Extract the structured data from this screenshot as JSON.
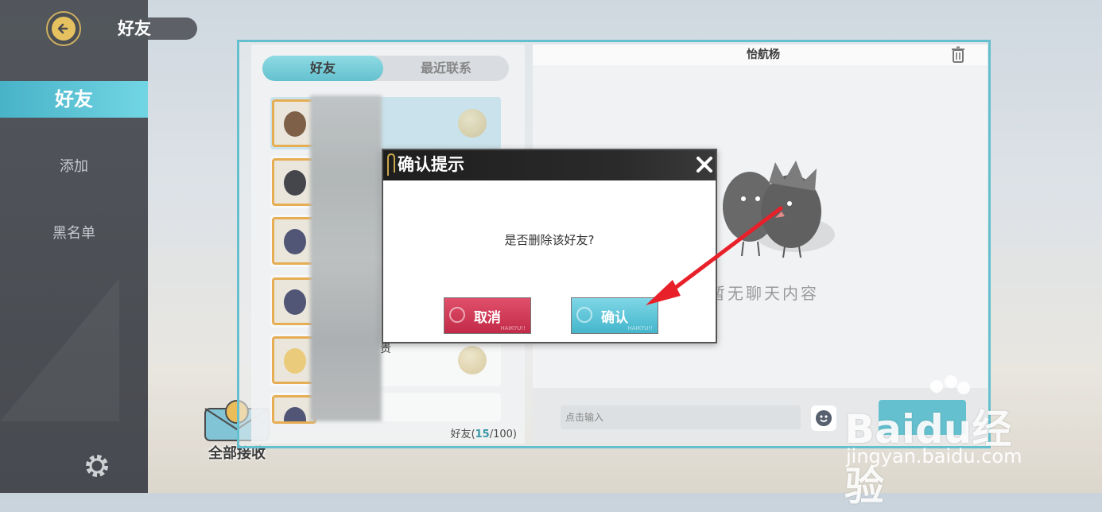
{
  "header": {
    "title": "好友"
  },
  "sidebar": {
    "items": [
      {
        "label": "好友",
        "active": true
      },
      {
        "label": "添加",
        "active": false
      },
      {
        "label": "黑名单",
        "active": false
      }
    ]
  },
  "receive_all": {
    "label": "全部接收"
  },
  "friends": {
    "tabs": [
      {
        "label": "好友",
        "active": true
      },
      {
        "label": "最近联系",
        "active": false
      }
    ],
    "count_prefix": "好友(",
    "count_current": "15",
    "count_suffix": "/100)",
    "stray_char": "贵"
  },
  "chat": {
    "title": "怡航杨",
    "empty_text": "暂无聊天内容",
    "input_placeholder": "点击输入"
  },
  "dialog": {
    "title": "确认提示",
    "message": "是否删除该好友?",
    "cancel_label": "取消",
    "confirm_label": "确认",
    "button_sub": "HAIKYU!!"
  },
  "watermark": {
    "brand": "Baidu经验",
    "site": "jingyan.baidu.com"
  },
  "colors": {
    "accent": "#4fb8c8",
    "cancel": "#c22a48",
    "confirm": "#44b6cc",
    "arrow": "#e8202a"
  },
  "icons": [
    "back-arrow-icon",
    "gear-icon",
    "trash-icon",
    "emoji-icon",
    "close-icon",
    "check-icon",
    "paperclip-icon",
    "paw-icon"
  ]
}
